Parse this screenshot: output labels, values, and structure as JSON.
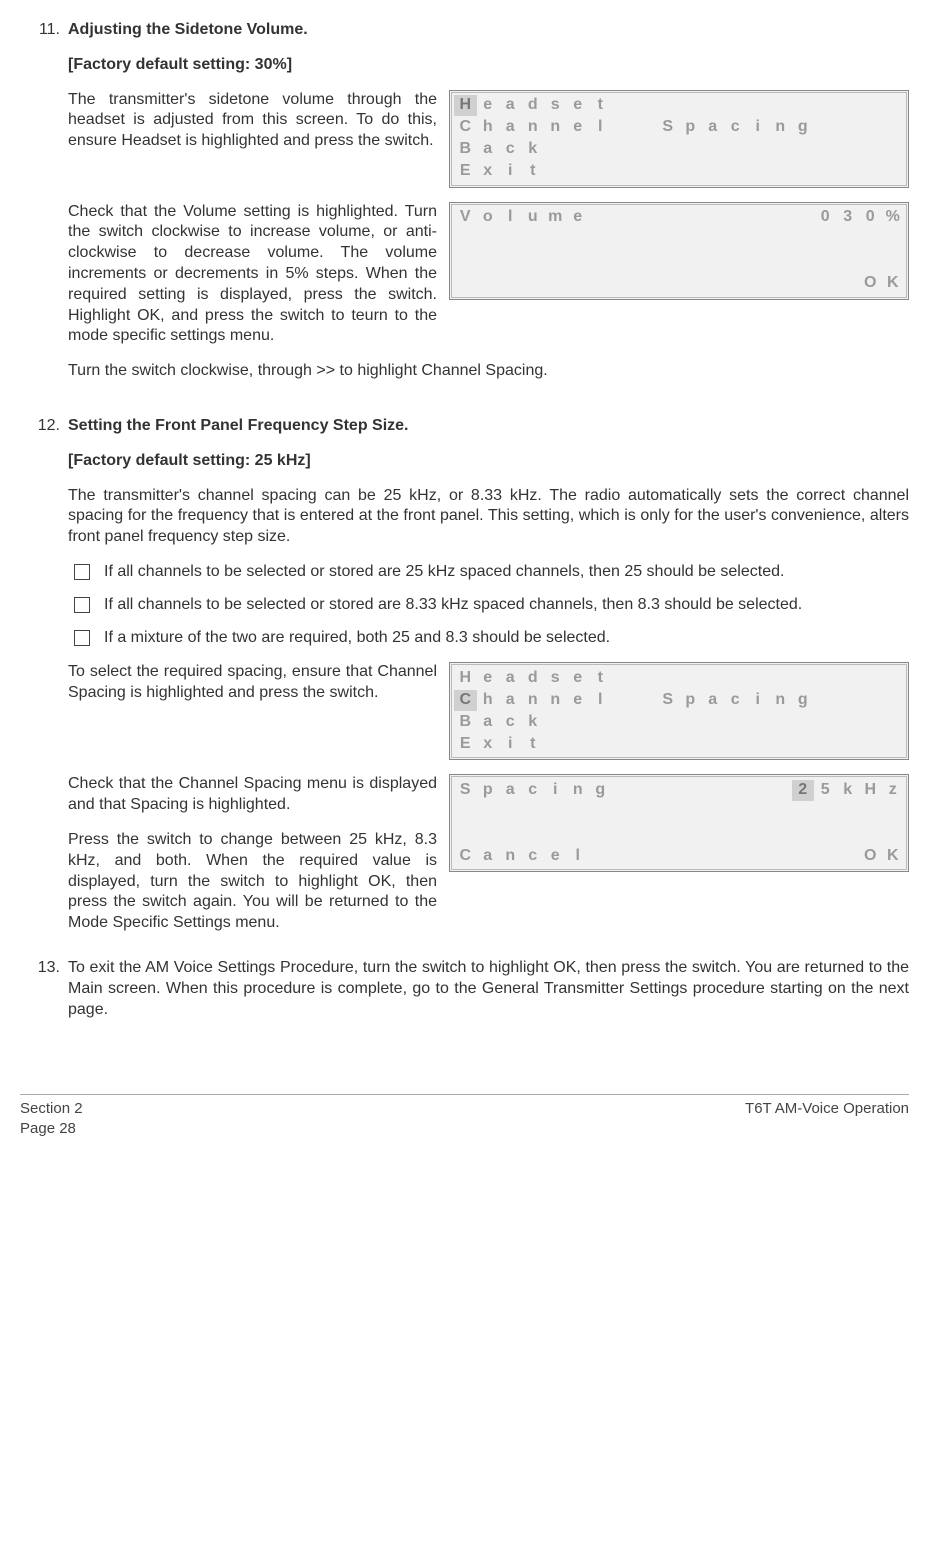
{
  "step11": {
    "num": "11.",
    "title": "Adjusting the Sidetone Volume.",
    "default": "[Factory default setting: 30%]",
    "p1": "The transmitter's sidetone volume through the headset is adjusted from this screen. To do this, ensure Headset is highlighted and press the switch.",
    "p2": "Check that the Volume setting is highlighted. Turn the switch clockwise to increase volume, or anti-clockwise to decrease volume. The volume increments or decrements in 5% steps. When the required setting is displayed, press the switch. Highlight OK, and press the switch to teurn to the mode specific settings menu.",
    "p3": "Turn the switch clockwise, through >> to highlight Channel Spacing."
  },
  "lcd1": {
    "r1": [
      "H",
      "e",
      "a",
      "d",
      "s",
      "e",
      "t"
    ],
    "r2": [
      "C",
      "h",
      "a",
      "n",
      "n",
      "e",
      "l",
      "",
      " ",
      "S",
      "p",
      "a",
      "c",
      "i",
      "n",
      "g"
    ],
    "r3": [
      "B",
      "a",
      "c",
      "k"
    ],
    "r4": [
      "E",
      "x",
      "i",
      "t"
    ]
  },
  "lcd2": {
    "left": [
      "V",
      "o",
      "l",
      "u",
      "m",
      "e"
    ],
    "right": [
      "0",
      "3",
      "0",
      "%"
    ],
    "ok": [
      "O",
      "K"
    ]
  },
  "step12": {
    "num": "12.",
    "title": "Setting the Front Panel Frequency Step Size.",
    "default": "[Factory default setting: 25 kHz]",
    "p1": "The   transmitter's channel spacing can be 25 kHz, or 8.33 kHz. The radio automatically sets the correct channel spacing for the frequency that is entered at the front panel. This setting, which is only for the user's convenience, alters front panel frequency step size.",
    "b1": "If all channels to be selected or stored are 25 kHz spaced channels, then 25 should be selected.",
    "b2": "If all channels to be selected or stored are 8.33 kHz spaced channels, then 8.3 should be selected.",
    "b3": "If a mixture of the two are required, both 25 and 8.3 should be selected.",
    "p2": "To select the required spacing, ensure that Channel Spacing is highlighted and press the switch.",
    "p3": "Check that the Channel Spacing menu is displayed and that Spacing is highlighted.",
    "p4": "Press the switch to change between 25 kHz, 8.3 kHz, and both. When the required value is displayed, turn the switch to highlight OK, then press the switch again. You will be returned to the Mode Specific Settings menu."
  },
  "lcd3": {
    "r1": [
      "H",
      "e",
      "a",
      "d",
      "s",
      "e",
      "t"
    ],
    "r2": [
      "C",
      "h",
      "a",
      "n",
      "n",
      "e",
      "l",
      "",
      " ",
      "S",
      "p",
      "a",
      "c",
      "i",
      "n",
      "g"
    ],
    "r3": [
      "B",
      "a",
      "c",
      "k"
    ],
    "r4": [
      "E",
      "x",
      "i",
      "t"
    ]
  },
  "lcd4": {
    "r1_left": [
      "S",
      "p",
      "a",
      "c",
      "i",
      "n",
      "g"
    ],
    "r1_right": [
      "2",
      "5",
      "k",
      "H",
      "z"
    ],
    "r4_left": [
      "C",
      "a",
      "n",
      "c",
      "e",
      "l"
    ],
    "r4_right": [
      "O",
      "K"
    ]
  },
  "step13": {
    "num": "13.",
    "p": "To exit the AM Voice Settings Procedure, turn the switch to highlight OK, then press the switch. You are returned to the Main screen. When this procedure is complete, go to the General Transmitter Settings procedure starting on the next page."
  },
  "footer": {
    "left1": "Section 2",
    "left2": "Page 28",
    "right": "T6T AM-Voice Operation"
  }
}
